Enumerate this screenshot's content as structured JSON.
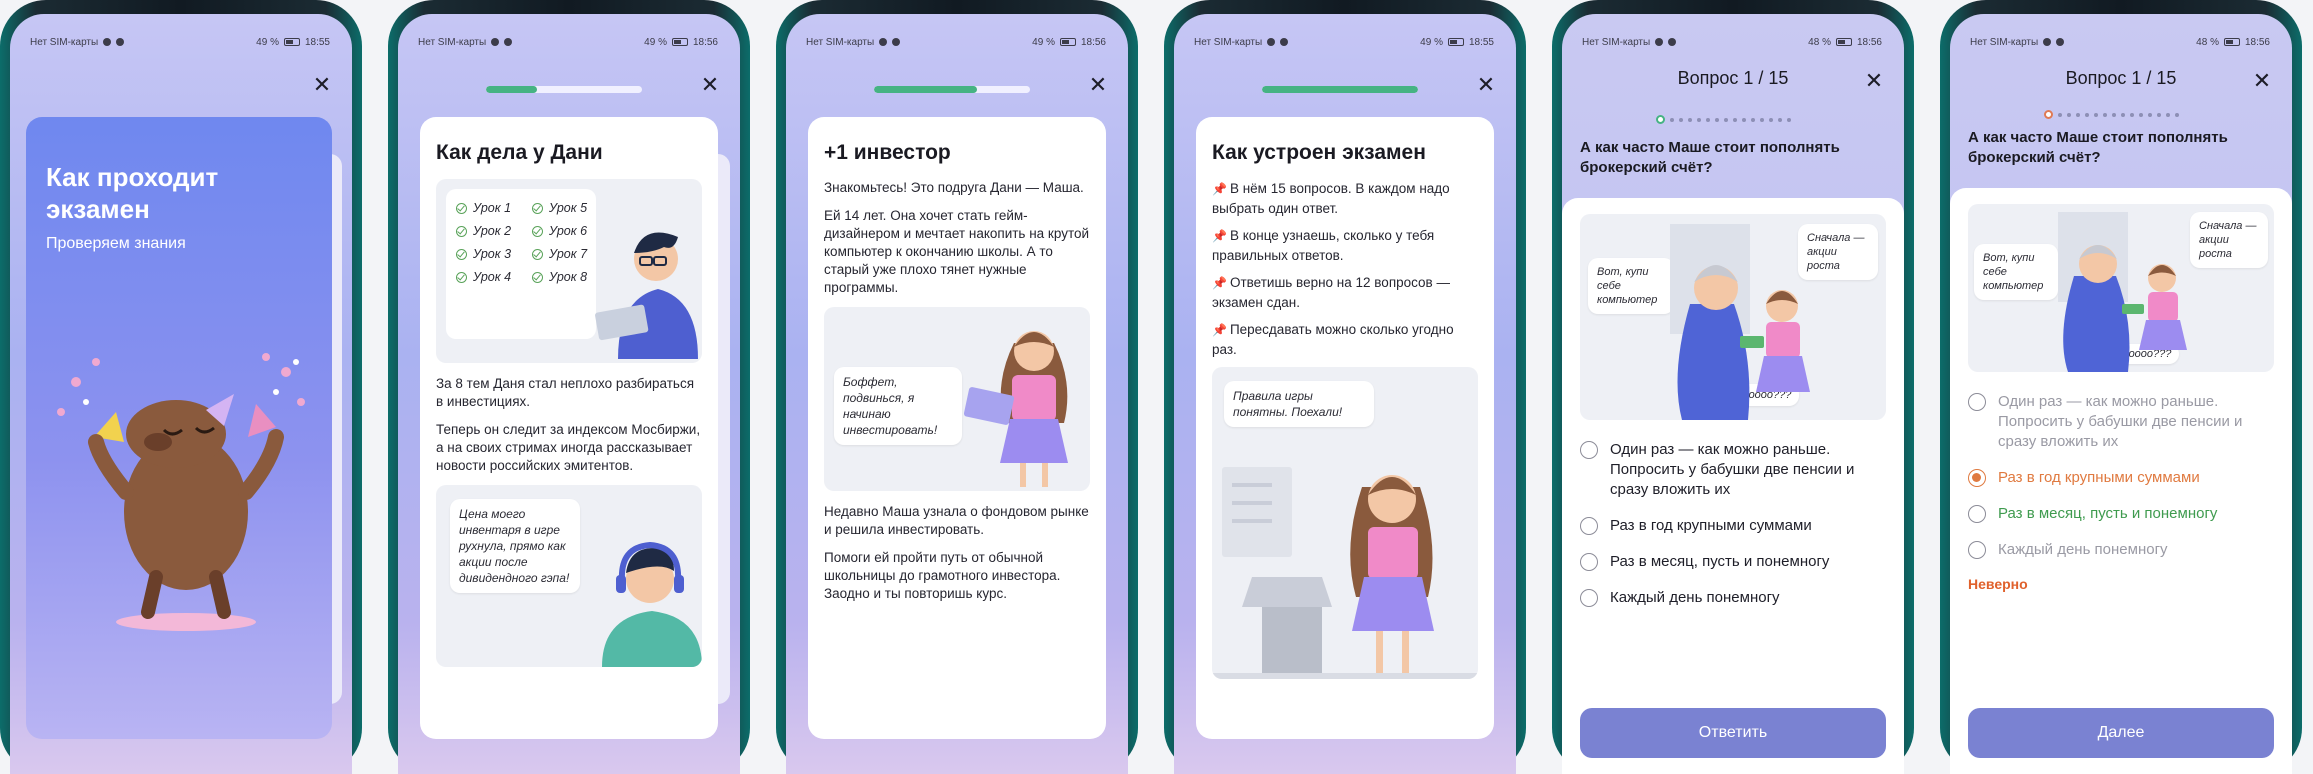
{
  "status_bars": [
    {
      "carrier": "Нет SIM-карты",
      "battery": "49 %",
      "time": "18:55"
    },
    {
      "carrier": "Нет SIM-карты",
      "battery": "49 %",
      "time": "18:56"
    },
    {
      "carrier": "Нет SIM-карты",
      "battery": "49 %",
      "time": "18:56"
    },
    {
      "carrier": "Нет SIM-карты",
      "battery": "49 %",
      "time": "18:55"
    },
    {
      "carrier": "Нет SIM-карты",
      "battery": "48 %",
      "time": "18:56"
    },
    {
      "carrier": "Нет SIM-карты",
      "battery": "48 %",
      "time": "18:56"
    }
  ],
  "close_glyph": "✕",
  "colors": {
    "accent": "#7a82d2",
    "progress": "#45b383",
    "wrong": "#e07a40",
    "correct": "#3f9b4f"
  },
  "screen1": {
    "title": "Как проходит экзамен",
    "subtitle": "Проверяем знания"
  },
  "screen2": {
    "progress": 0.33,
    "title": "Как дела у Дани",
    "lessons": [
      "Урок 1",
      "Урок 5",
      "Урок 2",
      "Урок 6",
      "Урок 3",
      "Урок 7",
      "Урок 4",
      "Урок 8"
    ],
    "p1": "За 8 тем Даня стал неплохо разбираться в инвестициях.",
    "p2": "Теперь он следит за индексом Мосбиржи, а на своих стримах иногда рассказывает новости российских эмитентов.",
    "bubble": "Цена моего инвентаря в игре рухнула, прямо как акции после дивидендного гэпа!"
  },
  "screen3": {
    "progress": 0.66,
    "title": "+1 инвестор",
    "p1": "Знакомьтесь! Это подруга Дани — Маша.",
    "p2": "Ей 14 лет. Она хочет стать гейм-дизайнером и мечтает накопить на крутой компьютер к окончанию школы. А то старый уже плохо тянет нужные программы.",
    "bubble": "Боффет, подвинься, я начинаю инвестировать!",
    "p3": "Недавно Маша узнала о фондовом рынке и решила инвестировать.",
    "p4": "Помоги ей пройти путь от обычной школьницы до грамотного инвестора. Заодно и ты повторишь курс."
  },
  "screen4": {
    "progress": 1.0,
    "title": "Как устроен экзамен",
    "rules": [
      "В нём 15 вопросов. В каждом надо выбрать один ответ.",
      "В конце узнаешь, сколько у тебя правильных ответов.",
      "Ответишь верно на 12 вопросов — экзамен сдан.",
      "Пересдавать можно сколько угодно раз."
    ],
    "bubble": "Правила игры понятны. Поехали!"
  },
  "quiz": {
    "header": "Вопрос 1 / 15",
    "question": "А как часто Маше стоит пополнять брокерский счёт?",
    "bubble_left": "Вот, купи себе компьютер",
    "bubble_right": "Сначала — акции роста",
    "bubble_bottom": "Чтооооо???",
    "options": [
      "Один раз — как можно раньше. Попросить у бабушки две пенсии и сразу вложить их",
      "Раз в год крупными суммами",
      "Раз в месяц, пусть и понемногу",
      "Каждый день понемногу"
    ],
    "submit": "Ответить",
    "next": "Далее",
    "verdict": "Неверно"
  }
}
